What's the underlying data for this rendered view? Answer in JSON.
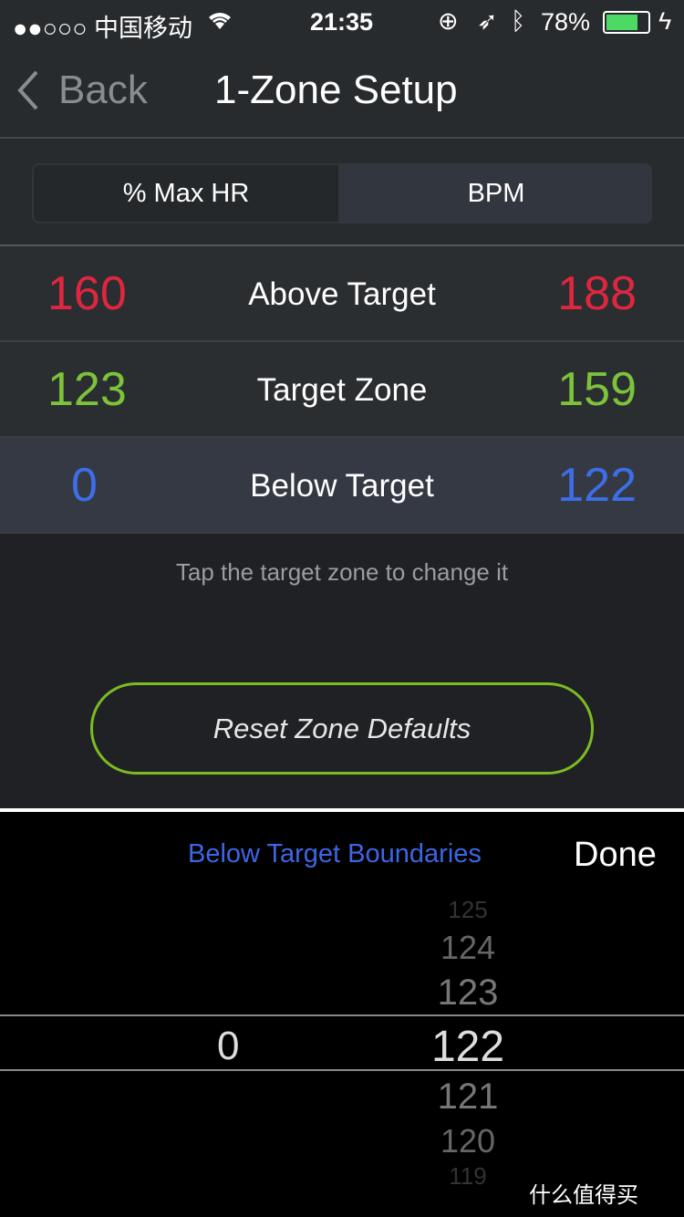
{
  "status": {
    "carrier": "●●○○○ 中国移动",
    "time": "21:35",
    "battery": "78%",
    "battery_level": 78
  },
  "nav": {
    "back": "Back",
    "title": "1-Zone Setup"
  },
  "segments": [
    {
      "label": "% Max HR",
      "selected": false
    },
    {
      "label": "BPM",
      "selected": true
    }
  ],
  "zones": [
    {
      "low": "160",
      "name": "Above Target",
      "high": "188",
      "color": "#e0263f"
    },
    {
      "low": "123",
      "name": "Target Zone",
      "high": "159",
      "color": "#7cc33a"
    },
    {
      "low": "0",
      "name": "Below Target",
      "high": "122",
      "color": "#3d6ee8"
    }
  ],
  "hint": "Tap the target zone to change it",
  "reset": "Reset Zone Defaults",
  "picker": {
    "title": "Below Target Boundaries",
    "done": "Done",
    "left_value": "0",
    "values": [
      "125",
      "124",
      "123",
      "122",
      "121",
      "120",
      "119"
    ],
    "selected": "122"
  },
  "watermark": "什么值得买"
}
